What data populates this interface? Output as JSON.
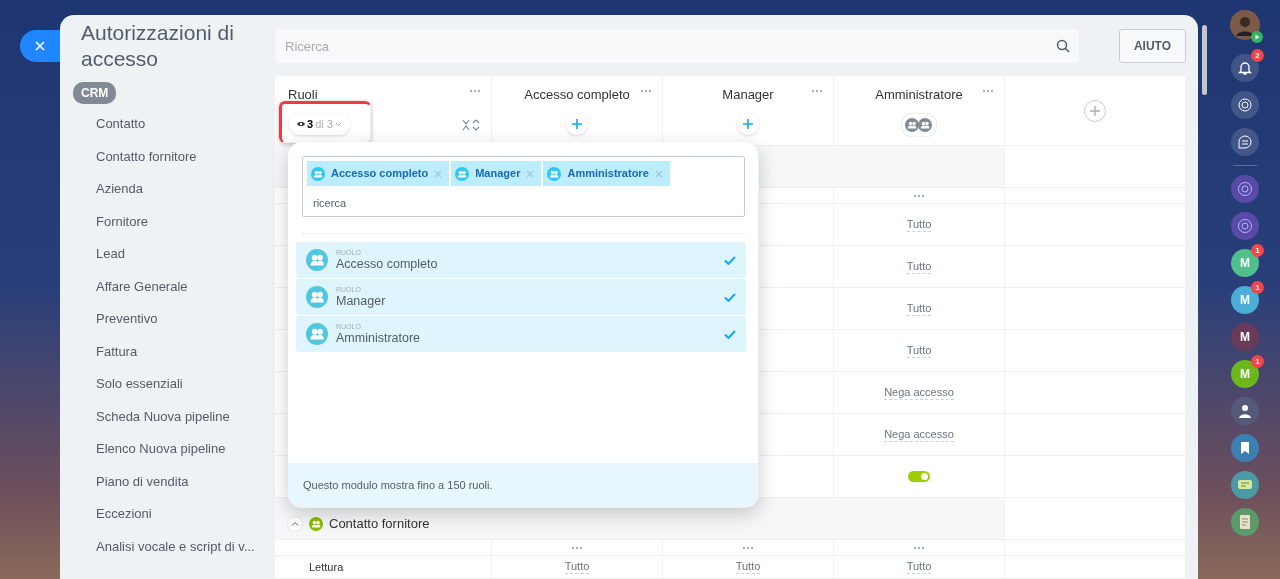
{
  "title": "Autorizzazioni di accesso",
  "sidebar": {
    "group": "CRM",
    "items": [
      {
        "label": "Contatto",
        "selected": false
      },
      {
        "label": "Contatto fornitore",
        "selected": false
      },
      {
        "label": "Azienda",
        "selected": false
      },
      {
        "label": "Fornitore",
        "selected": false
      },
      {
        "label": "Lead",
        "selected": false
      },
      {
        "label": "Affare Generale",
        "selected": false
      },
      {
        "label": "Preventivo",
        "selected": false
      },
      {
        "label": "Fattura",
        "selected": false
      },
      {
        "label": "Solo essenziali",
        "selected": false
      },
      {
        "label": "Scheda Nuova pipeline",
        "selected": false
      },
      {
        "label": "Elenco Nuova pipeline",
        "selected": false
      },
      {
        "label": "Piano di vendita",
        "selected": false
      },
      {
        "label": "Eccezioni",
        "selected": false
      },
      {
        "label": "Analisi vocale e script di v..."
      }
    ]
  },
  "search": {
    "placeholder": "Ricerca"
  },
  "help_button": "AIUTO",
  "roles_column": {
    "title": "Ruoli",
    "counter": {
      "shown": "3",
      "total": "di 3"
    }
  },
  "columns": [
    {
      "title": "Accesso completo",
      "kind": "add"
    },
    {
      "title": "Manager",
      "kind": "add"
    },
    {
      "title": "Amministratore",
      "kind": "avatars"
    }
  ],
  "permission_rows": [
    {
      "kind": "text",
      "value": "Tutto"
    },
    {
      "kind": "text",
      "value": "Tutto"
    },
    {
      "kind": "text",
      "value": "Tutto"
    },
    {
      "kind": "text",
      "value": "Tutto"
    },
    {
      "kind": "text",
      "value": "Nega accesso"
    },
    {
      "kind": "text",
      "value": "Nega accesso"
    },
    {
      "kind": "toggle",
      "on": true
    }
  ],
  "section": {
    "title": "Contatto fornitore",
    "expanded": true,
    "rows": [
      {
        "label": "Lettura",
        "values": [
          "Tutto",
          "Tutto",
          "Tutto"
        ]
      }
    ]
  },
  "popup": {
    "tags": [
      {
        "label": "Accesso completo"
      },
      {
        "label": "Manager"
      },
      {
        "label": "Amministratore"
      }
    ],
    "search_placeholder": "ricerca",
    "items": [
      {
        "category": "RUOLO",
        "label": "Accesso completo",
        "selected": true
      },
      {
        "category": "RUOLO",
        "label": "Manager",
        "selected": true
      },
      {
        "category": "RUOLO",
        "label": "Amministratore",
        "selected": true
      }
    ],
    "footer": "Questo modulo mostra fino a 150 ruoli."
  },
  "right_bar": {
    "notifications": "2",
    "chats": [
      {
        "letter": "M",
        "color": "#4fbf8c",
        "badge": "1"
      },
      {
        "letter": "M",
        "color": "#4aaed6",
        "badge": "1"
      },
      {
        "letter": "M",
        "color": "#6a3a5a"
      },
      {
        "letter": "M",
        "color": "#6cb71b",
        "badge": "1"
      }
    ]
  }
}
